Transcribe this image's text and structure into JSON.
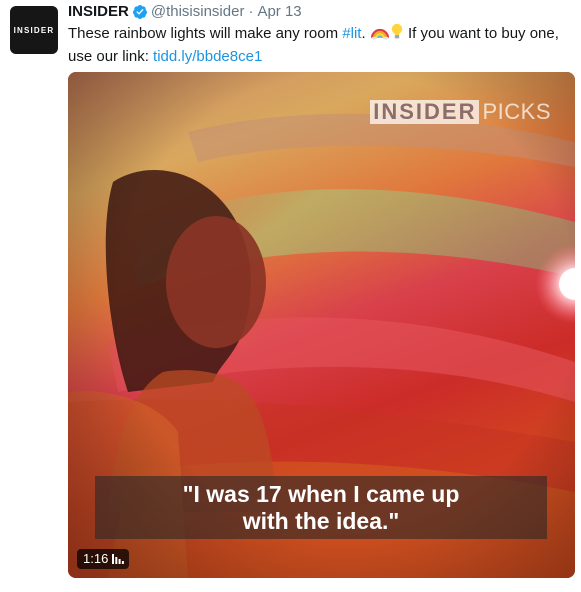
{
  "tweet": {
    "avatar_text": "INSIDER",
    "display_name": "INSIDER",
    "handle": "@thisisinsider",
    "separator": "·",
    "date": "Apr 13",
    "text_before_hashtag": "These rainbow lights will make any room ",
    "hashtag": "#lit",
    "text_after_hashtag": ".",
    "emoji_1": "rainbow-emoji",
    "emoji_2": "lightbulb-emoji",
    "text_after_emoji": " If you want to buy one, use our link: ",
    "link": "tidd.ly/bbde8ce1"
  },
  "video": {
    "watermark_insider": "INSIDER",
    "watermark_picks": "PICKS",
    "caption_line1": "\"I was 17 when I came up",
    "caption_line2": "with the idea.\"",
    "duration": "1:16",
    "duration_icon": "bars-icon"
  },
  "colors": {
    "link": "#1b95e0",
    "verified": "#1da1f2",
    "meta_text": "#657786"
  }
}
